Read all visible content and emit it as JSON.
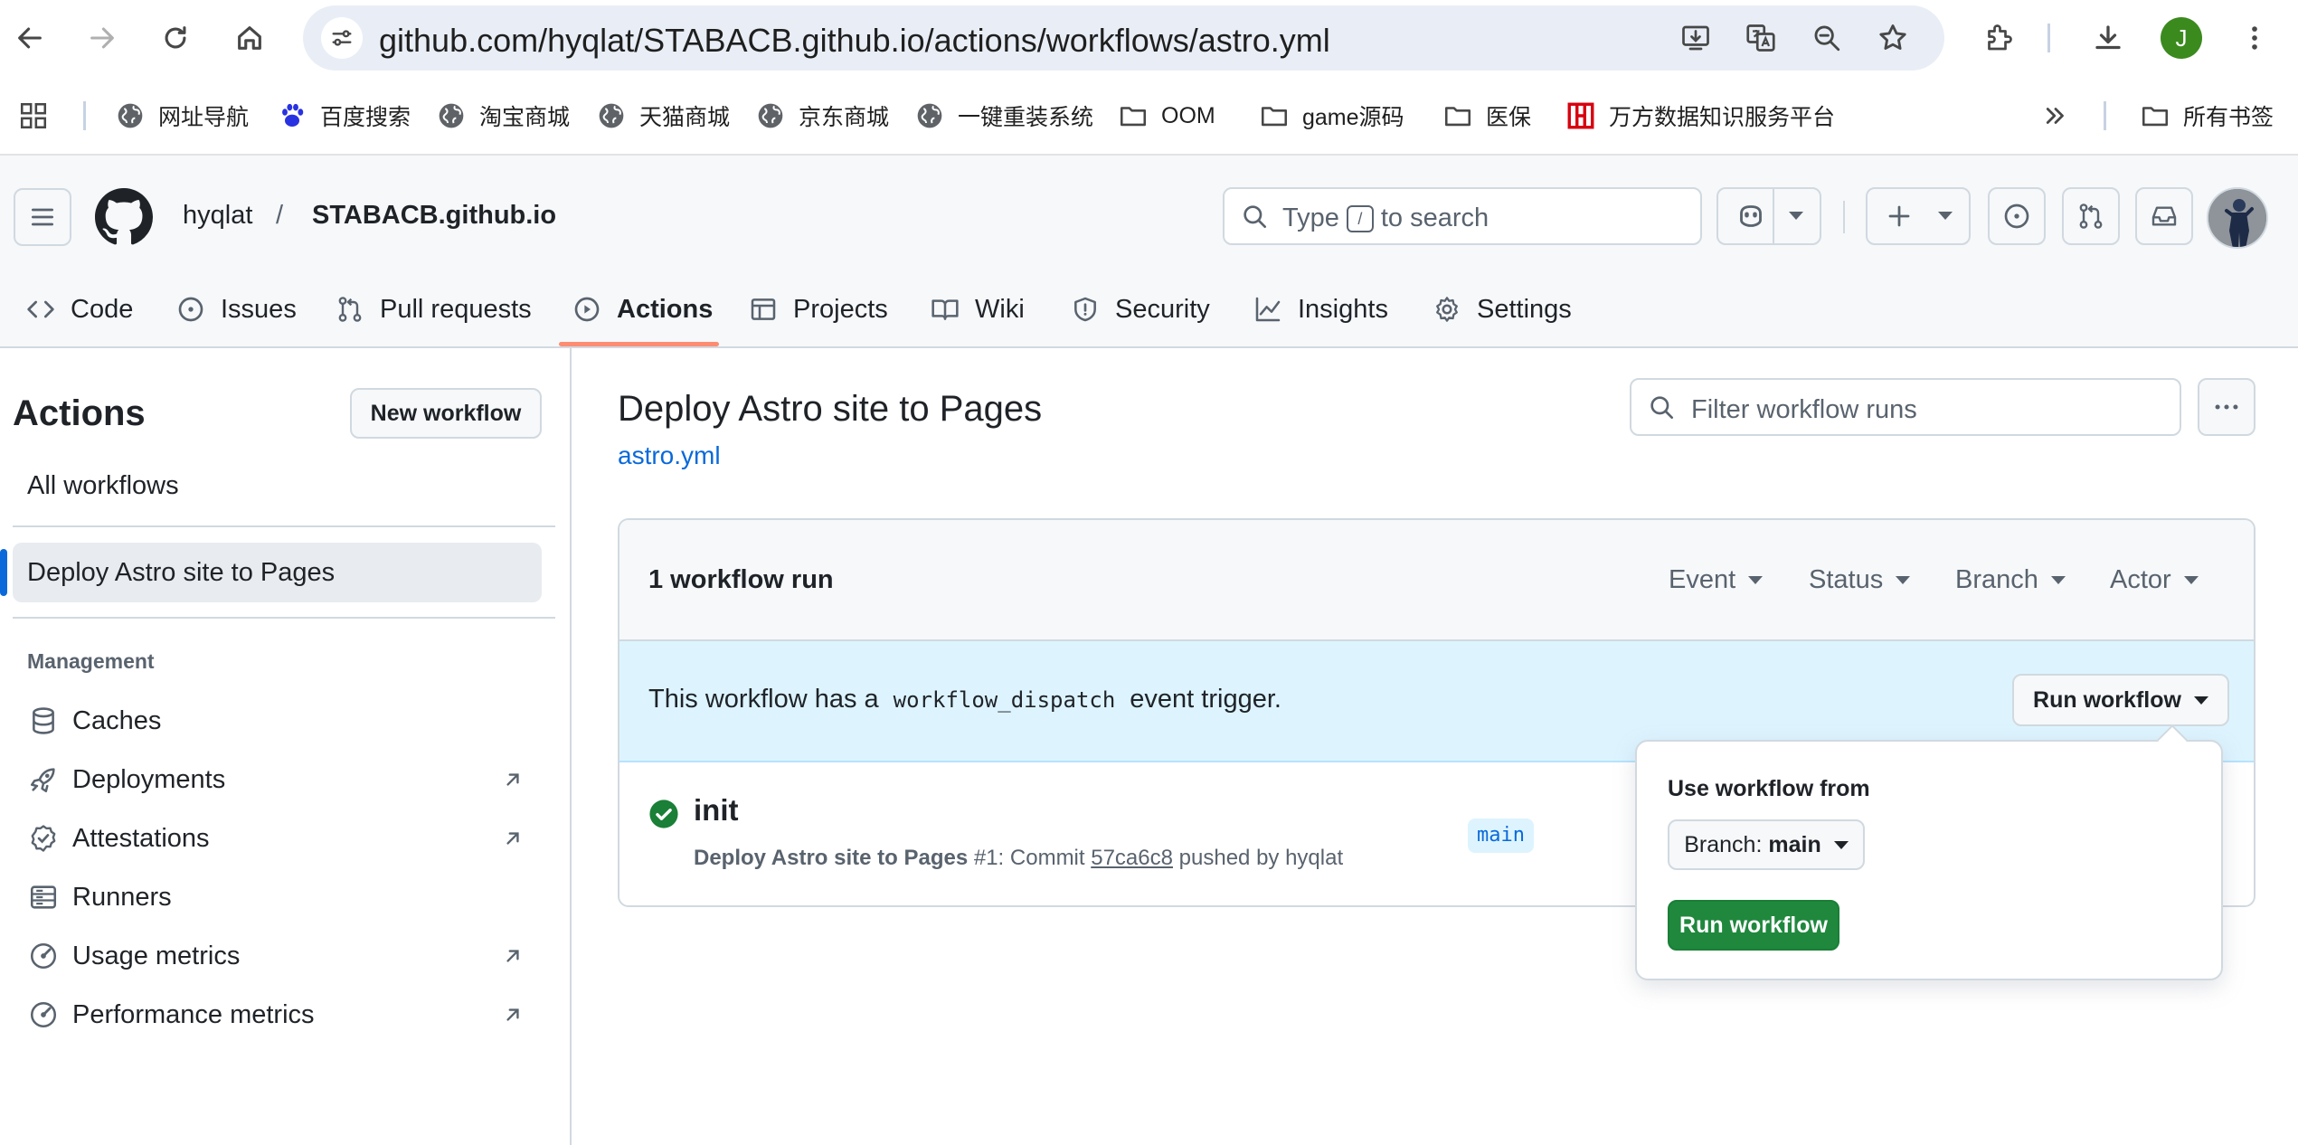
{
  "browser": {
    "url": "github.com/hyqlat/STABACB.github.io/actions/workflows/astro.yml",
    "profile_initial": "J",
    "profile_color": "#3b8a1e",
    "bookmarks": [
      {
        "label": "网址导航",
        "icon": "globe-icon"
      },
      {
        "label": "百度搜索",
        "icon": "baidu-paw-icon"
      },
      {
        "label": "淘宝商城",
        "icon": "globe-icon"
      },
      {
        "label": "天猫商城",
        "icon": "globe-icon"
      },
      {
        "label": "京东商城",
        "icon": "globe-icon"
      },
      {
        "label": "一键重装系统",
        "icon": "globe-icon"
      },
      {
        "label": "OOM",
        "icon": "folder-icon"
      },
      {
        "label": "game源码",
        "icon": "folder-icon"
      },
      {
        "label": "医保",
        "icon": "folder-icon"
      },
      {
        "label": "万方数据知识服务平台",
        "icon": "wanfang-icon"
      }
    ],
    "all_bookmarks": "所有书签"
  },
  "github": {
    "owner": "hyqlat",
    "separator": "/",
    "repo": "STABACB.github.io",
    "search": {
      "prefix": "Type",
      "key": "/",
      "suffix": "to search"
    },
    "tabs": [
      {
        "label": "Code",
        "icon": "code-icon"
      },
      {
        "label": "Issues",
        "icon": "issue-icon"
      },
      {
        "label": "Pull requests",
        "icon": "pull-request-icon"
      },
      {
        "label": "Actions",
        "icon": "play-icon",
        "active": true
      },
      {
        "label": "Projects",
        "icon": "table-icon"
      },
      {
        "label": "Wiki",
        "icon": "book-icon"
      },
      {
        "label": "Security",
        "icon": "shield-icon"
      },
      {
        "label": "Insights",
        "icon": "graph-icon"
      },
      {
        "label": "Settings",
        "icon": "gear-icon"
      }
    ],
    "accent_color": "#fd8c73"
  },
  "sidebar": {
    "title": "Actions",
    "new_workflow": "New workflow",
    "all_workflows": "All workflows",
    "active_workflow": "Deploy Astro site to Pages",
    "management_heading": "Management",
    "items": [
      {
        "label": "Caches",
        "icon": "database-icon",
        "external": false
      },
      {
        "label": "Deployments",
        "icon": "rocket-icon",
        "external": true
      },
      {
        "label": "Attestations",
        "icon": "verified-icon",
        "external": true
      },
      {
        "label": "Runners",
        "icon": "server-icon",
        "external": false
      },
      {
        "label": "Usage metrics",
        "icon": "meter-icon",
        "external": true
      },
      {
        "label": "Performance metrics",
        "icon": "meter-icon",
        "external": true
      }
    ]
  },
  "main": {
    "title": "Deploy Astro site to Pages",
    "file": "astro.yml",
    "filter_placeholder": "Filter workflow runs",
    "runs_count": "1 workflow run",
    "filters": [
      "Event",
      "Status",
      "Branch",
      "Actor"
    ],
    "dispatch": {
      "prefix": "This workflow has a",
      "code": "workflow_dispatch",
      "suffix": "event trigger.",
      "button": "Run workflow"
    },
    "run": {
      "title": "init",
      "workflow": "Deploy Astro site to Pages",
      "number": "#1: Commit",
      "sha": "57ca6c8",
      "pushed_by": "pushed by hyqlat",
      "branch": "main",
      "status": "success",
      "status_color": "#1a7f37"
    },
    "popover": {
      "label": "Use workflow from",
      "branch_prefix": "Branch:",
      "branch_value": "main",
      "run_button": "Run workflow",
      "run_color": "#1f883d"
    }
  }
}
